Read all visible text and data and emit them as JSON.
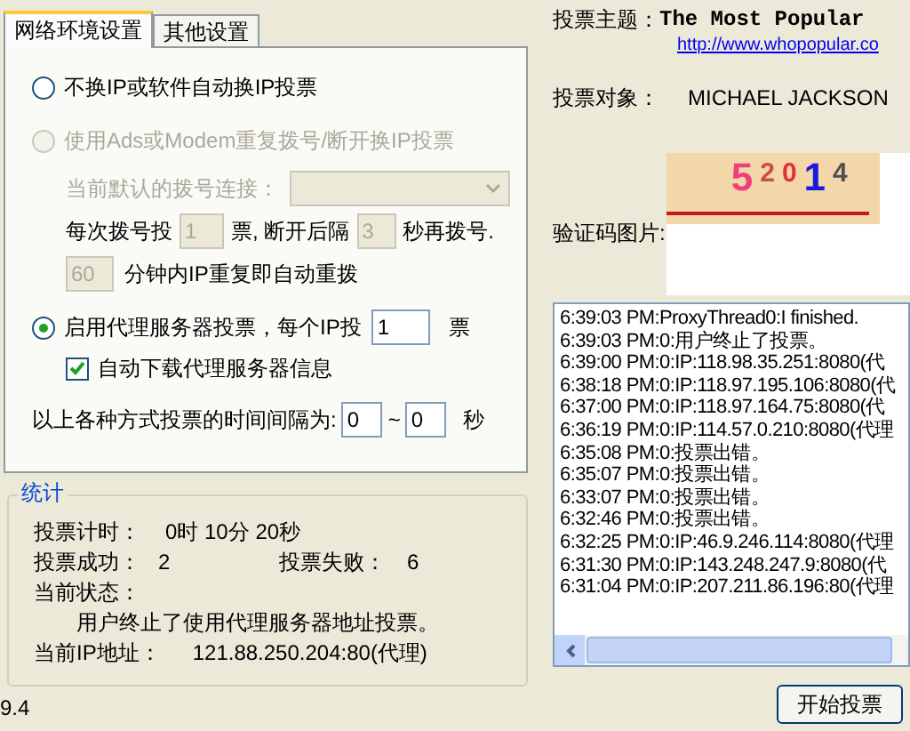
{
  "tabs": [
    {
      "label": "网络环境设置",
      "selected": true
    },
    {
      "label": "其他设置",
      "selected": false
    }
  ],
  "options": [
    {
      "label": "不换IP或软件自动换IP投票",
      "selected": false,
      "disabled": false
    },
    {
      "label": "使用Ads或Modem重复拨号/断开换IP投票",
      "selected": false,
      "disabled": true
    },
    {
      "label": "启用代理服务器投票，每个IP投",
      "selected": true,
      "disabled": false
    }
  ],
  "dial": {
    "connection_label": "当前默认的拨号连接：",
    "votes_prefix": "每次拨号投",
    "votes_value": "1",
    "votes_suffix": "票, 断开后隔",
    "wait_value": "3",
    "wait_suffix": "秒再拨号.",
    "repeat_value": "60",
    "repeat_suffix": "分钟内IP重复即自动重拨"
  },
  "proxy": {
    "votes_value": "1",
    "votes_suffix": "票",
    "auto_download": {
      "label": "自动下载代理服务器信息",
      "checked": true
    }
  },
  "interval": {
    "label": "以上各种方式投票的时间间隔为:",
    "from": "0",
    "sep": "~",
    "to": "0",
    "unit": "秒"
  },
  "stats": {
    "title": "统计",
    "timer_label": "投票计时：",
    "timer": "0时 10分 20秒",
    "success_label": "投票成功：",
    "success": "2",
    "fail_label": "投票失败：",
    "fail": "6",
    "status_label": "当前状态：",
    "status": "用户终止了使用代理服务器地址投票。",
    "ip_label": "当前IP地址：",
    "ip": "121.88.250.204:80(代理)"
  },
  "version": "9.4",
  "topic": {
    "label": "投票主题：",
    "title": "The Most Popular",
    "url": "http://www.whopopular.co"
  },
  "target": {
    "label": "投票对象：",
    "value": "MICHAEL JACKSON"
  },
  "captcha": {
    "label": "验证码图片:",
    "chars": [
      {
        "char": "5",
        "color": "#f0407a"
      },
      {
        "char": "2",
        "color": "#c8503c"
      },
      {
        "char": "0",
        "color": "#e03030"
      },
      {
        "char": "1",
        "color": "#1a1ae0"
      },
      {
        "char": "4",
        "color": "#505050"
      }
    ]
  },
  "log": [
    "6:39:03 PM:ProxyThread0:I finished.",
    "6:39:03 PM:0:用户终止了投票。",
    "6:39:00 PM:0:IP:118.98.35.251:8080(代",
    "6:38:18 PM:0:IP:118.97.195.106:8080(代",
    "6:37:00 PM:0:IP:118.97.164.75:8080(代",
    "6:36:19 PM:0:IP:114.57.0.210:8080(代理",
    "6:35:08 PM:0:投票出错。",
    "6:35:07 PM:0:投票出错。",
    "6:33:07 PM:0:投票出错。",
    "6:32:46 PM:0:投票出错。",
    "6:32:25 PM:0:IP:46.9.246.114:8080(代理",
    "6:31:30 PM:0:IP:143.248.247.9:8080(代",
    "6:31:04 PM:0:IP:207.211.86.196:80(代理"
  ],
  "start_button": "开始投票"
}
